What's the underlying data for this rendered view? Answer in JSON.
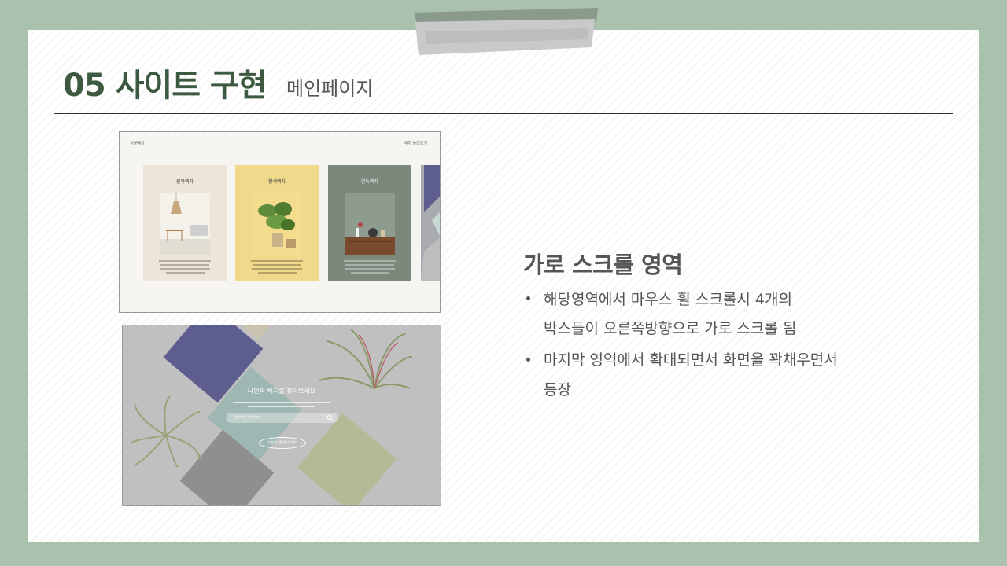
{
  "slide": {
    "title": "05 사이트 구현",
    "subtitle": "메인페이지"
  },
  "screenshot_main": {
    "logo": "식물액자",
    "menu": "액자 둘러보기",
    "cards": [
      {
        "title": "원목액자",
        "bg": "#ede6d8"
      },
      {
        "title": "황색액자",
        "bg": "#f0d98a"
      },
      {
        "title": "연녹액자",
        "bg": "#7c887c"
      }
    ]
  },
  "screenshot_search": {
    "title": "나만의 백지를 찾아보세요",
    "search_placeholder": "원목액자 / 황색액자",
    "button_label": "식물액자를 둘러보세요"
  },
  "content": {
    "heading": "가로 스크롤 영역",
    "bullets": [
      {
        "line1": "해당영역에서 마우스 휠 스크롤시 4개의",
        "line2": "박스들이 오른쪽방향으로 가로 스크롤 됨"
      },
      {
        "line1": "마지막 영역에서 확대되면서  화면을 꽉채우면서",
        "line2": "등장"
      }
    ]
  },
  "colors": {
    "frame": "#a9c1ad",
    "title": "#3d5a41",
    "tape": "#8a9a8c"
  }
}
